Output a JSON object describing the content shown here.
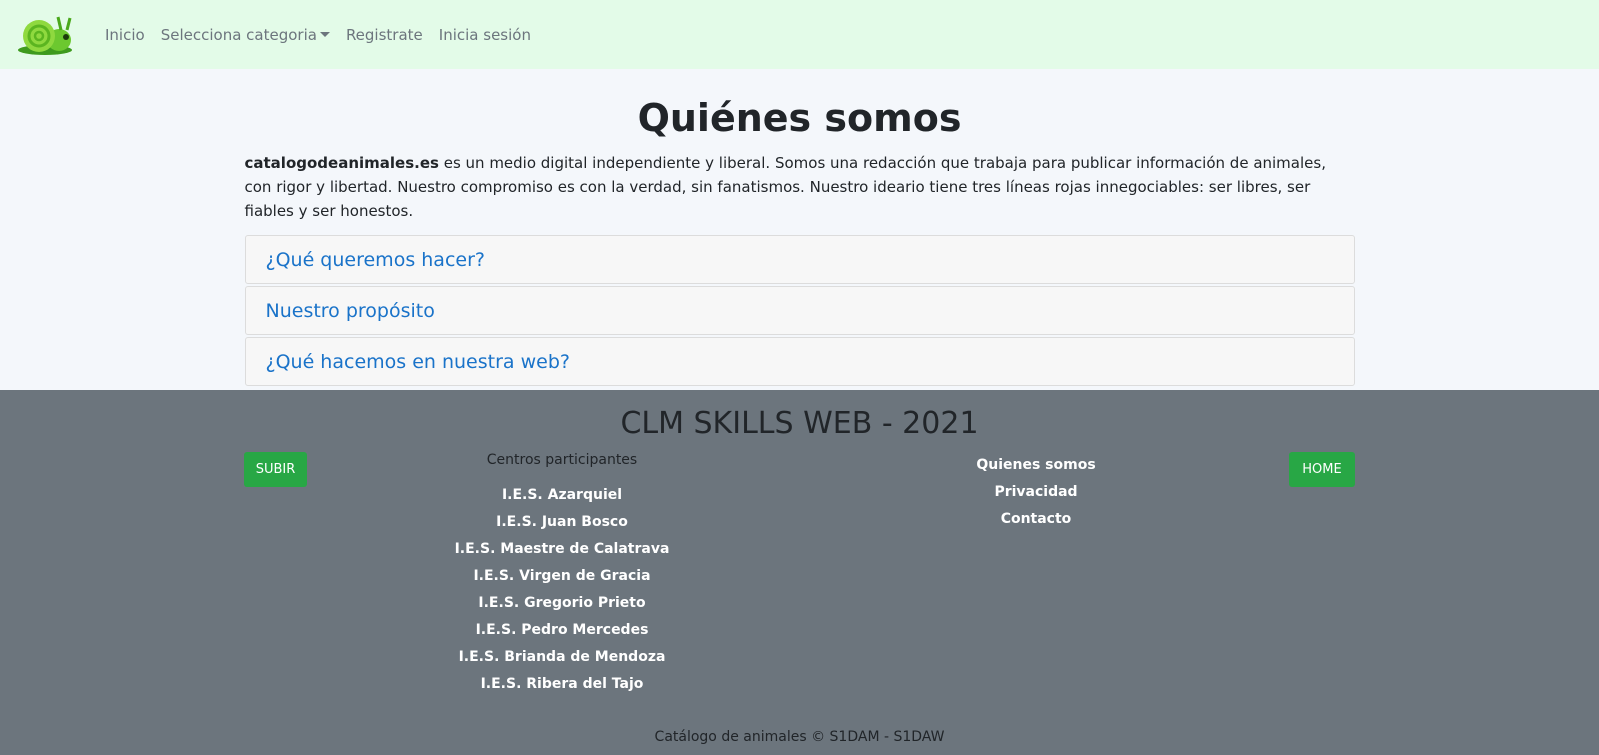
{
  "nav": {
    "logo_icon": "snail-logo-icon",
    "items": [
      {
        "label": "Inicio"
      },
      {
        "label": "Selecciona categoria",
        "dropdown": true
      },
      {
        "label": "Registrate"
      },
      {
        "label": "Inicia sesión"
      }
    ]
  },
  "main": {
    "title": "Quiénes somos",
    "intro_brand": "catalogodeanimales.es",
    "intro_text": " es un medio digital independiente y liberal. Somos una redacción que trabaja para publicar información de animales, con rigor y libertad. Nuestro compromiso es con la verdad, sin fanatismos. Nuestro ideario tiene tres líneas rojas innegociables: ser libres, ser fiables y ser honestos.",
    "accordion": [
      {
        "label": "¿Qué queremos hacer?"
      },
      {
        "label": "Nuestro propósito"
      },
      {
        "label": "¿Qué hacemos en nuestra web?"
      }
    ]
  },
  "footer": {
    "title": "CLM SKILLS WEB - 2021",
    "subir_label": "SUBIR",
    "home_label": "HOME",
    "centros_heading": "Centros participantes",
    "centros": [
      "I.E.S. Azarquiel",
      "I.E.S. Juan Bosco",
      "I.E.S. Maestre de Calatrava",
      "I.E.S. Virgen de Gracia",
      "I.E.S. Gregorio Prieto",
      "I.E.S. Pedro Mercedes",
      "I.E.S. Brianda de Mendoza",
      "I.E.S. Ribera del Tajo"
    ],
    "links": [
      {
        "label": "Quienes somos"
      },
      {
        "label": "Privacidad"
      },
      {
        "label": "Contacto"
      }
    ],
    "copyright": "Catálogo de animales © S1DAM - S1DAW"
  },
  "colors": {
    "navbar_bg": "#e3fbe8",
    "footer_bg": "#6c757d",
    "accent_green": "#28a745",
    "link_blue": "#1a73c9"
  }
}
